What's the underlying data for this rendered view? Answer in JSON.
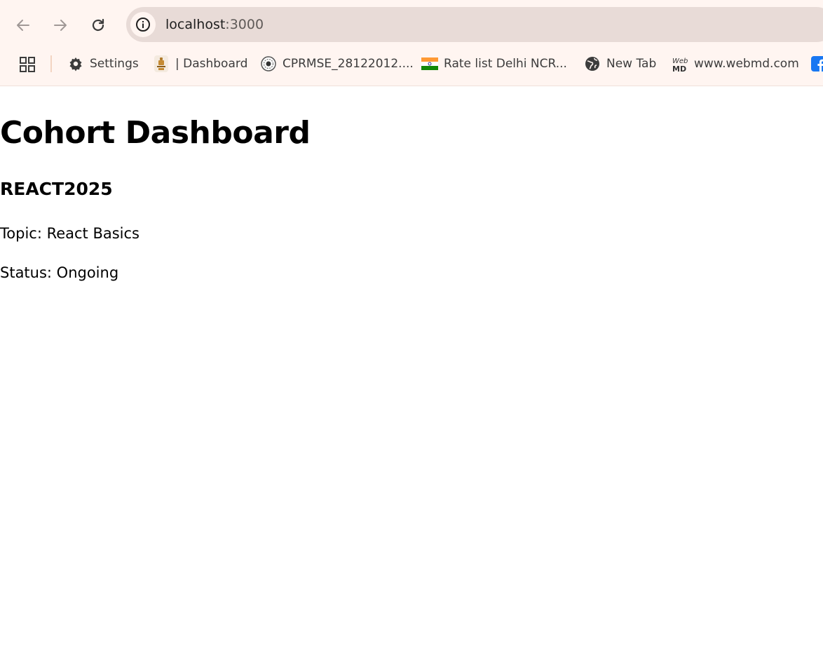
{
  "browser": {
    "url_host": "localhost",
    "url_port": ":3000",
    "bookmarks": [
      {
        "label": "Settings",
        "icon": "gear-icon"
      },
      {
        "label": "| Dashboard",
        "icon": "emblem-icon"
      },
      {
        "label": "CPRMSE_28122012....",
        "icon": "seal-icon"
      },
      {
        "label": "Rate list Delhi NCR...",
        "icon": "india-flag-icon"
      },
      {
        "label": "New Tab",
        "icon": "globe-icon"
      },
      {
        "label": "www.webmd.com",
        "icon": "webmd-icon"
      },
      {
        "label": "",
        "icon": "facebook-icon"
      }
    ],
    "webmd_logo_text": "WebMD"
  },
  "page": {
    "title": "Cohort Dashboard",
    "cohort_code": "REACT2025",
    "topic_line": "Topic: React Basics",
    "status_line": "Status: Ongoing"
  },
  "colors": {
    "chrome_bg": "#fff5f1",
    "address_bar_bg": "#e8dbd7",
    "facebook_blue": "#1877f2"
  }
}
